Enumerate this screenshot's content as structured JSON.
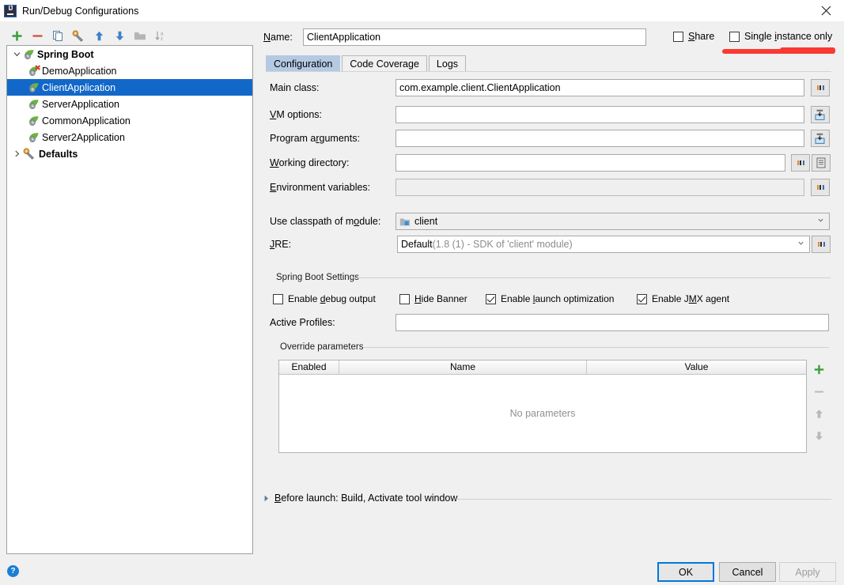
{
  "window": {
    "title": "Run/Debug Configurations",
    "app_icon": "intellij-idea-icon",
    "close_icon": "close-icon"
  },
  "toolbar": {
    "buttons": [
      {
        "name": "add-configuration-button",
        "icon": "plus-icon"
      },
      {
        "name": "remove-configuration-button",
        "icon": "minus-icon"
      },
      {
        "name": "copy-configuration-button",
        "icon": "copy-icon"
      },
      {
        "name": "edit-templates-button",
        "icon": "wrench-icon"
      },
      {
        "name": "move-up-button",
        "icon": "arrow-up-icon"
      },
      {
        "name": "move-down-button",
        "icon": "arrow-down-icon"
      },
      {
        "name": "create-folder-button",
        "icon": "folder-icon"
      },
      {
        "name": "sort-configurations-button",
        "icon": "sort-alpha-icon"
      }
    ]
  },
  "tree": {
    "nodes": [
      {
        "label": "Spring Boot",
        "type": "group",
        "icon": "spring-boot-icon",
        "expanded": true,
        "selected": false
      },
      {
        "label": "DemoApplication",
        "type": "child",
        "icon": "spring-boot-error-icon",
        "selected": false
      },
      {
        "label": "ClientApplication",
        "type": "child",
        "icon": "spring-boot-icon",
        "selected": true
      },
      {
        "label": "ServerApplication",
        "type": "child",
        "icon": "spring-boot-icon",
        "selected": false
      },
      {
        "label": "CommonApplication",
        "type": "child",
        "icon": "spring-boot-icon",
        "selected": false
      },
      {
        "label": "Server2Application",
        "type": "child",
        "icon": "spring-boot-icon",
        "selected": false
      },
      {
        "label": "Defaults",
        "type": "group",
        "icon": "wrench-icon",
        "expanded": false,
        "selected": false
      }
    ]
  },
  "header": {
    "name_label": "Name:",
    "name_value": "ClientApplication",
    "share_label": "Share",
    "share_checked": false,
    "single_instance_label": "Single instance only",
    "single_instance_checked": false,
    "annotation": "red-underline-annotation"
  },
  "tabs": [
    {
      "label": "Configuration",
      "active": true
    },
    {
      "label": "Code Coverage",
      "active": false
    },
    {
      "label": "Logs",
      "active": false
    }
  ],
  "configuration": {
    "main_class_label": "Main class:",
    "main_class_value": "com.example.client.ClientApplication",
    "vm_options_label": "VM options:",
    "vm_options_value": "",
    "program_arguments_label": "Program arguments:",
    "program_arguments_value": "",
    "working_directory_label": "Working directory:",
    "working_directory_value": "",
    "environment_variables_label": "Environment variables:",
    "environment_variables_value": "",
    "classpath_label": "Use classpath of module:",
    "classpath_value": "client",
    "classpath_icon": "module-icon",
    "jre_label": "JRE:",
    "jre_value": "Default",
    "jre_hint": " (1.8 (1) - SDK of 'client' module)"
  },
  "spring_boot_settings": {
    "group_title": "Spring Boot Settings",
    "checkboxes": [
      {
        "label": "Enable debug output",
        "checked": false
      },
      {
        "label": "Hide Banner",
        "checked": false
      },
      {
        "label": "Enable launch optimization",
        "checked": true
      },
      {
        "label": "Enable JMX agent",
        "checked": true
      }
    ],
    "active_profiles_label": "Active Profiles:",
    "active_profiles_value": ""
  },
  "override_parameters": {
    "group_title": "Override parameters",
    "columns": [
      "Enabled",
      "Name",
      "Value"
    ],
    "rows": [],
    "empty_text": "No parameters",
    "side_buttons": [
      {
        "name": "add-parameter-button",
        "icon": "plus-icon",
        "enabled": true
      },
      {
        "name": "remove-parameter-button",
        "icon": "minus-icon",
        "enabled": false
      },
      {
        "name": "move-parameter-up-button",
        "icon": "arrow-up-icon",
        "enabled": false
      },
      {
        "name": "move-parameter-down-button",
        "icon": "arrow-down-icon",
        "enabled": false
      }
    ]
  },
  "before_launch": {
    "label": "Before launch: Build, Activate tool window",
    "expanded": false
  },
  "footer": {
    "help_label": "?",
    "ok_label": "OK",
    "cancel_label": "Cancel",
    "apply_label": "Apply",
    "apply_enabled": false
  },
  "colors": {
    "selection": "#1268c8",
    "accent": "#0078d7",
    "annotation": "#f93a33",
    "tab_active": "#b4c9e3",
    "dialog_bg": "#f0f0f0"
  }
}
